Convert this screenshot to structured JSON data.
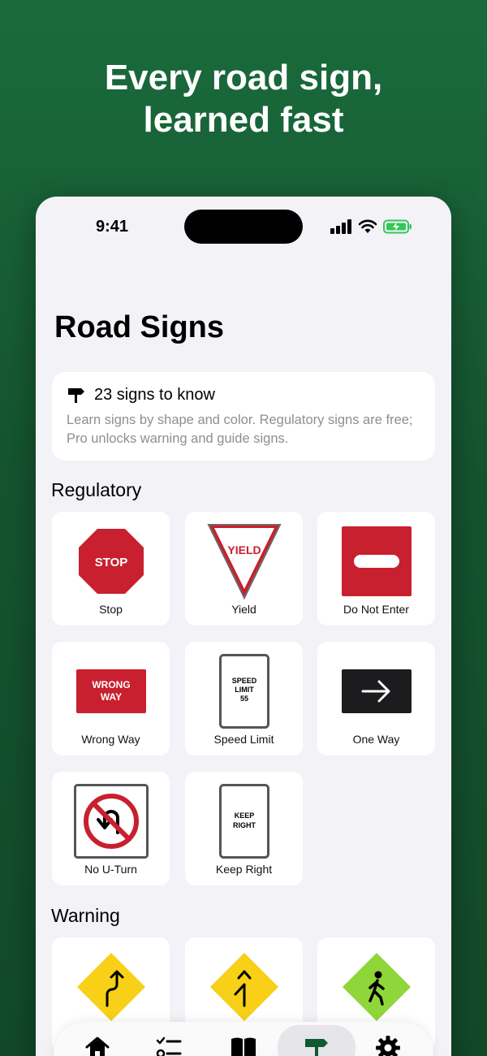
{
  "headline": {
    "line1": "Every road sign,",
    "line2": "learned fast"
  },
  "status": {
    "time": "9:41"
  },
  "page_title": "Road Signs",
  "info": {
    "heading": "23 signs to know",
    "body": "Learn signs by shape and color. Regulatory signs are free; Pro unlocks warning and guide signs."
  },
  "sections": {
    "regulatory": {
      "title": "Regulatory",
      "items": [
        {
          "label": "Stop",
          "sign_text": "STOP"
        },
        {
          "label": "Yield",
          "sign_text": "YIELD"
        },
        {
          "label": "Do Not Enter"
        },
        {
          "label": "Wrong Way",
          "sign_text_1": "WRONG",
          "sign_text_2": "WAY"
        },
        {
          "label": "Speed Limit",
          "sign_text_1": "SPEED",
          "sign_text_2": "LIMIT",
          "sign_text_3": "55"
        },
        {
          "label": "One Way"
        },
        {
          "label": "No U-Turn"
        },
        {
          "label": "Keep Right",
          "sign_text_1": "KEEP",
          "sign_text_2": "RIGHT"
        }
      ]
    },
    "warning": {
      "title": "Warning"
    }
  },
  "tabs": [
    "home-icon",
    "checklist-icon",
    "book-icon",
    "signpost-icon",
    "gear-icon"
  ],
  "colors": {
    "brand_green": "#1a6b3c",
    "sign_red": "#c8202e",
    "warning_yellow": "#f7d017",
    "school_green": "#8fd63a",
    "accent_active": "#0f5a32"
  }
}
